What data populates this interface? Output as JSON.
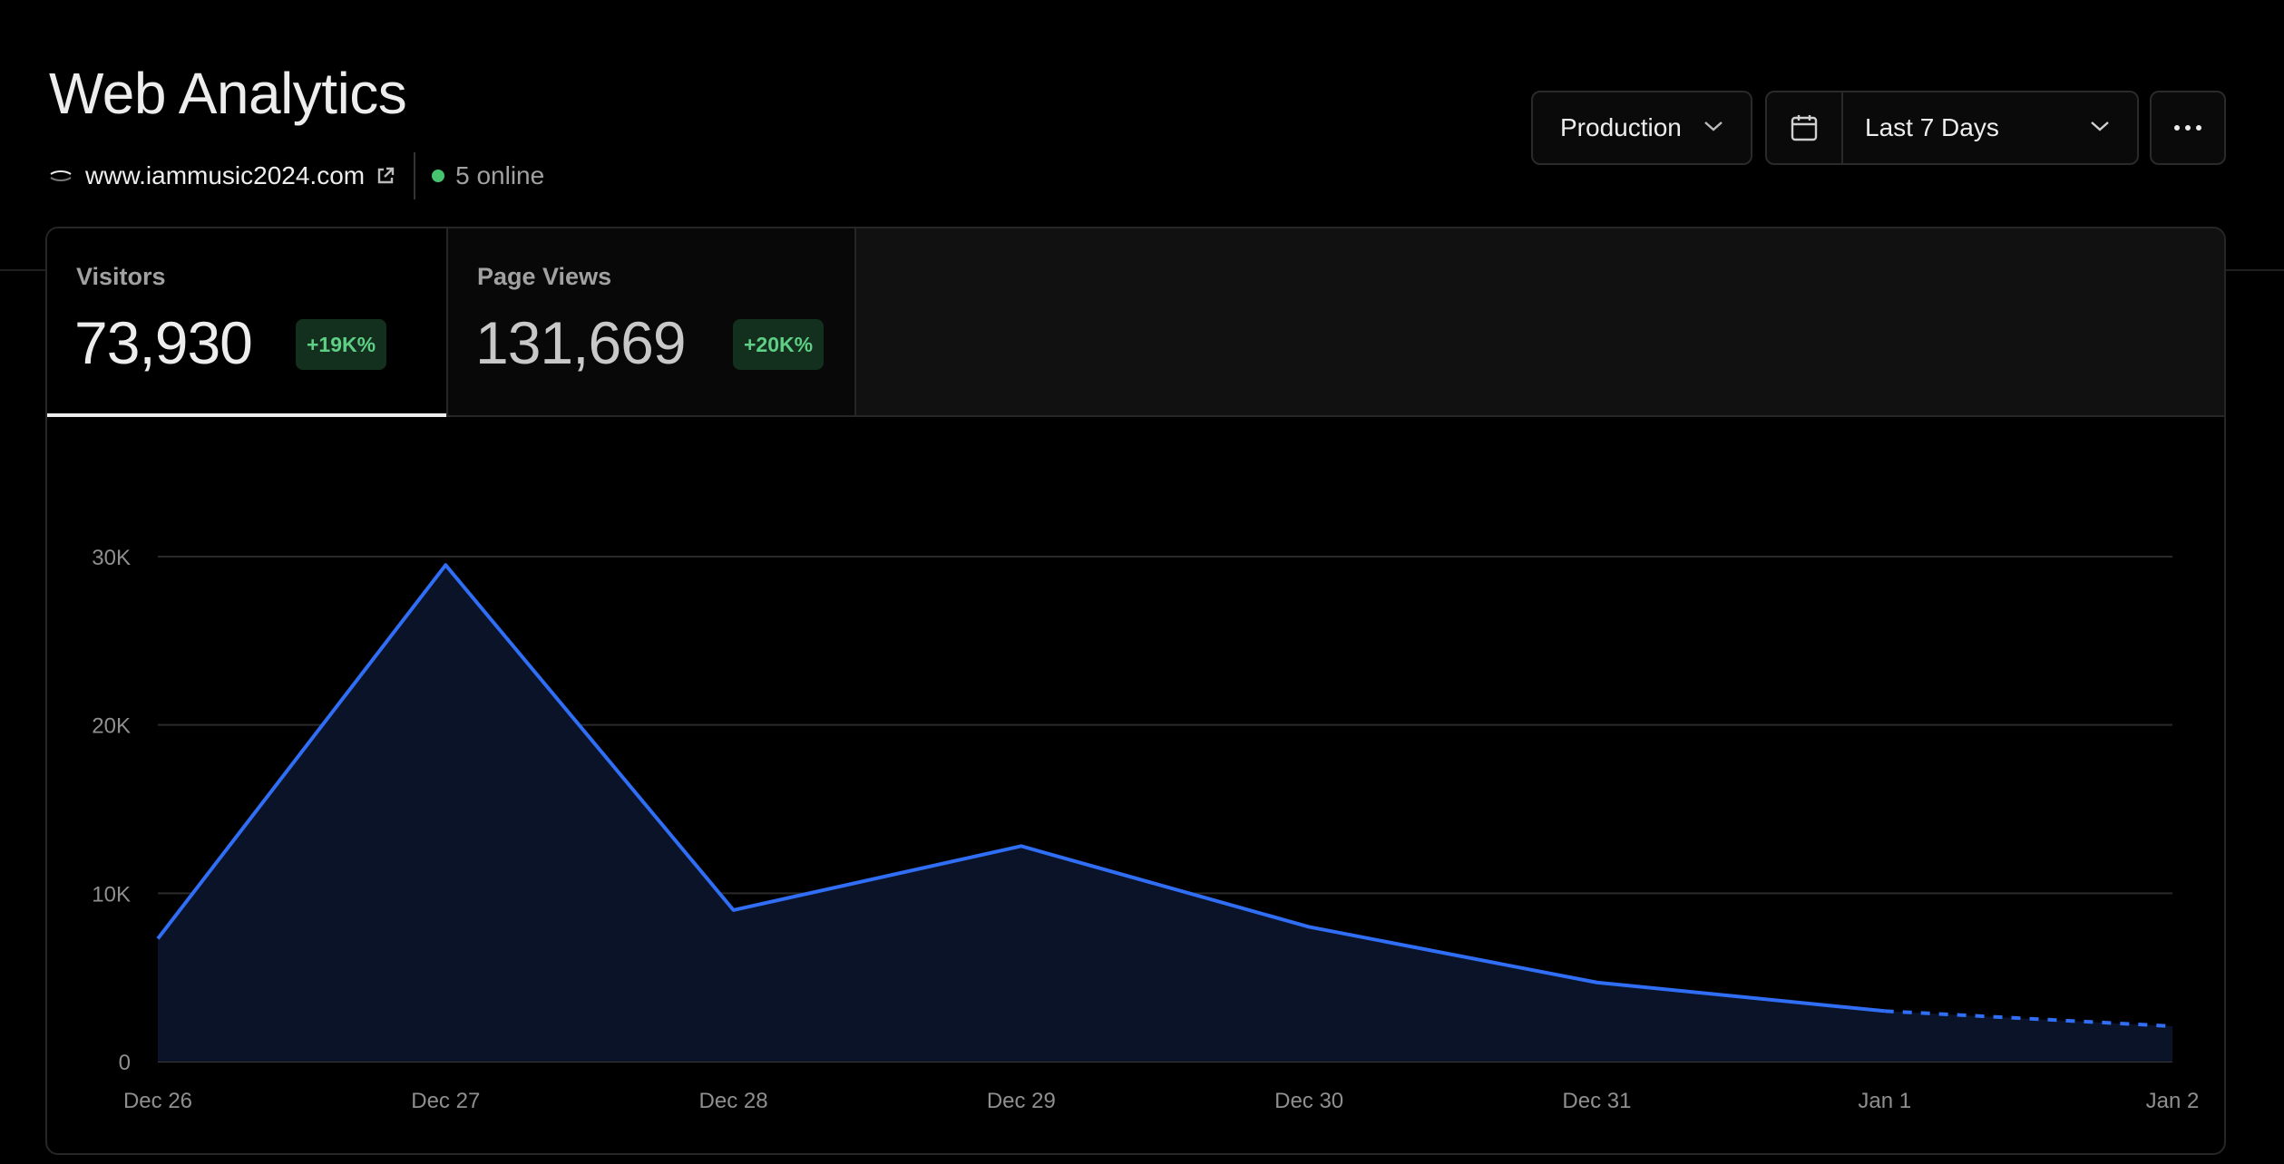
{
  "header": {
    "title": "Web Analytics",
    "site": "www.iammusic2024.com",
    "online": "5 online"
  },
  "controls": {
    "environment": "Production",
    "date_range": "Last 7 Days"
  },
  "metrics": [
    {
      "label": "Visitors",
      "value": "73,930",
      "delta": "+19K%"
    },
    {
      "label": "Page Views",
      "value": "131,669",
      "delta": "+20K%"
    }
  ],
  "colors": {
    "accent": "#2f6ef5",
    "area": "#0a1328",
    "positive": "#46c36f"
  },
  "chart_data": {
    "type": "area",
    "x": [
      "Dec 26",
      "Dec 27",
      "Dec 28",
      "Dec 29",
      "Dec 30",
      "Dec 31",
      "Jan 1",
      "Jan 2"
    ],
    "series": [
      {
        "values": [
          7300,
          29500,
          9000,
          12800,
          8000,
          4700,
          3000,
          2100
        ]
      }
    ],
    "partial_from_index": 6,
    "yticks": [
      0,
      10000,
      20000,
      30000
    ],
    "ytick_labels": [
      "0",
      "10K",
      "20K",
      "30K"
    ],
    "ylim": [
      0,
      30000
    ],
    "grid": true
  }
}
